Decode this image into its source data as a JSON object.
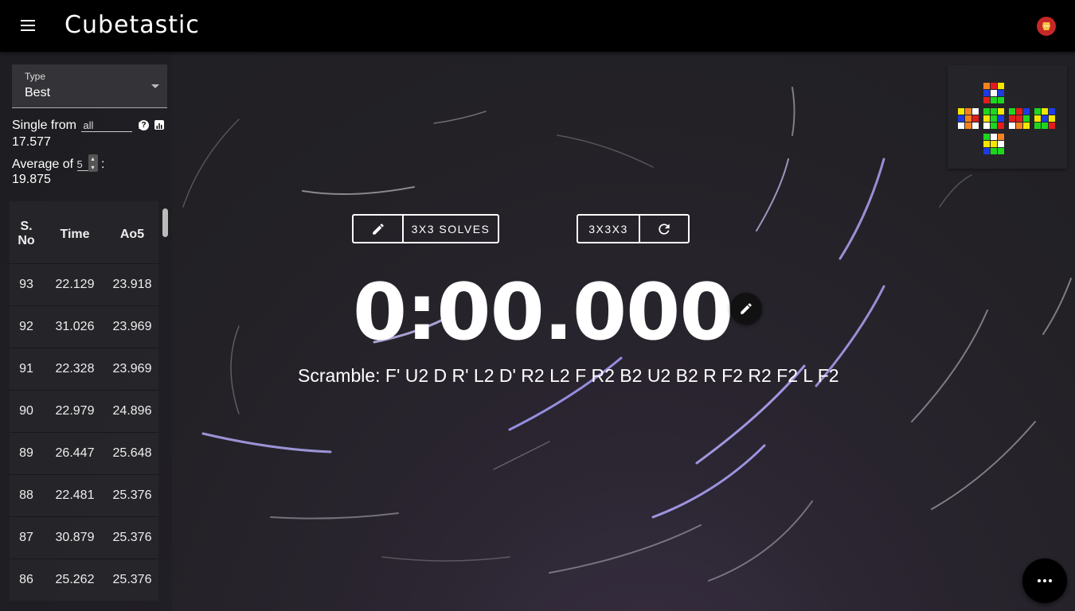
{
  "app": {
    "title": "Cubetastic"
  },
  "sidebar": {
    "type_select": {
      "label": "Type",
      "value": "Best"
    },
    "single": {
      "label_before": "Single from",
      "scope": "all",
      "label_after": ":",
      "value": "17.577"
    },
    "average": {
      "label_before": "Average of",
      "n": "5",
      "label_after": ":",
      "value": "19.875"
    },
    "table": {
      "headers": {
        "sno_line1": "S.",
        "sno_line2": "No",
        "time": "Time",
        "ao5": "Ao5"
      },
      "rows": [
        {
          "sno": "93",
          "time": "22.129",
          "ao5": "23.918"
        },
        {
          "sno": "92",
          "time": "31.026",
          "ao5": "23.969"
        },
        {
          "sno": "91",
          "time": "22.328",
          "ao5": "23.969"
        },
        {
          "sno": "90",
          "time": "22.979",
          "ao5": "24.896"
        },
        {
          "sno": "89",
          "time": "26.447",
          "ao5": "25.648"
        },
        {
          "sno": "88",
          "time": "22.481",
          "ao5": "25.376"
        },
        {
          "sno": "87",
          "time": "30.879",
          "ao5": "25.376"
        },
        {
          "sno": "86",
          "time": "25.262",
          "ao5": "25.376"
        }
      ]
    }
  },
  "controls": {
    "session_label": "3X3 SOLVES",
    "puzzle_label": "3X3X3"
  },
  "timer": {
    "value": "0:00.000"
  },
  "scramble": {
    "text": "Scramble: F' U2 D R' L2 D' R2 L2 F R2 B2 U2 B2 R F2 R2 F2 L F2"
  },
  "icons": {
    "menu": "menu-icon",
    "avatar": "iron-man-avatar-icon",
    "edit": "pencil-icon",
    "refresh": "refresh-icon",
    "help": "help-icon",
    "chart": "bar-chart-icon",
    "more": "more-horizontal-icon"
  },
  "colors": {
    "topbar": "#000000",
    "avatar": "#c62828"
  }
}
